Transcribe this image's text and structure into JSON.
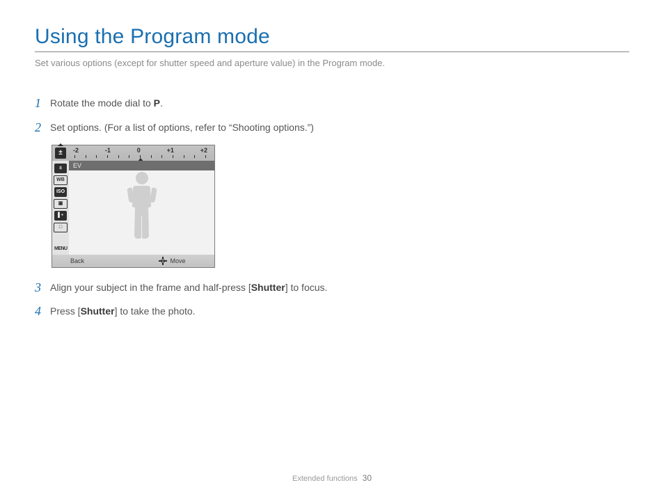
{
  "title": "Using the Program mode",
  "subtitle": "Set various options (except for shutter speed and aperture value) in the Program mode.",
  "steps": {
    "s1": {
      "num": "1",
      "pre": "Rotate the mode dial to ",
      "mode": "P",
      "post": "."
    },
    "s2": {
      "num": "2",
      "text": "Set options. (For a list of options, refer to “Shooting options.”)"
    },
    "s3": {
      "num": "3",
      "pre": "Align your subject in the frame and half-press [",
      "bold": "Shutter",
      "post": "] to focus."
    },
    "s4": {
      "num": "4",
      "pre": "Press [",
      "bold": "Shutter",
      "post": "] to take the photo."
    }
  },
  "lcd": {
    "ev_icon_label": "±",
    "scale": {
      "m2": "-2",
      "m1": "-1",
      "z": "0",
      "p1": "+1",
      "p2": "+2"
    },
    "ev_label": "EV",
    "side": {
      "i1": "±",
      "i2": "WB",
      "i3": "ISO",
      "i4": "▣",
      "i5": "▌•",
      "i6": "□",
      "menu": "MENU"
    },
    "bottom": {
      "back": "Back",
      "move": "Move"
    }
  },
  "footer": {
    "section": "Extended functions",
    "page": "30"
  }
}
